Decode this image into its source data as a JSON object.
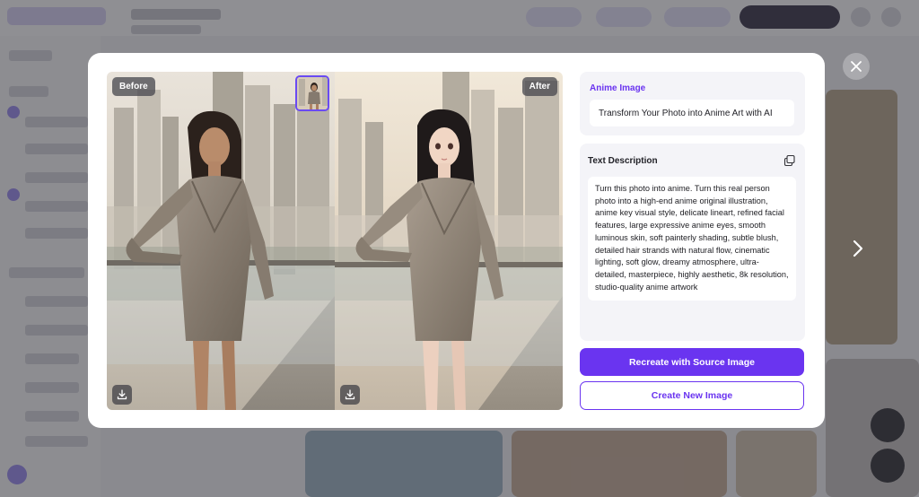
{
  "modal": {
    "before_tag": "Before",
    "after_tag": "After",
    "type_label": "Anime Image",
    "type_title": "Transform Your Photo into Anime Art with AI",
    "desc_label": "Text Description",
    "description": "Turn this photo into anime. Turn this real person photo into a high-end anime original illustration, anime key visual style, delicate lineart, refined facial features, large expressive anime eyes, smooth luminous skin, soft painterly shading, subtle blush, detailed hair strands with natural flow, cinematic lighting, soft glow, dreamy atmosphere, ultra-detailed, masterpiece, highly aesthetic, 8k resolution, studio-quality anime artwork",
    "primary_button": "Recreate with Source Image",
    "secondary_button": "Create New Image"
  },
  "icons": {
    "close": "close-icon",
    "next": "chevron-right-icon",
    "download": "download-icon",
    "copy": "copy-icon"
  },
  "colors": {
    "accent": "#6a34f0",
    "overlay": "rgba(40,40,48,0.52)",
    "panel_bg": "#f4f4f8"
  }
}
